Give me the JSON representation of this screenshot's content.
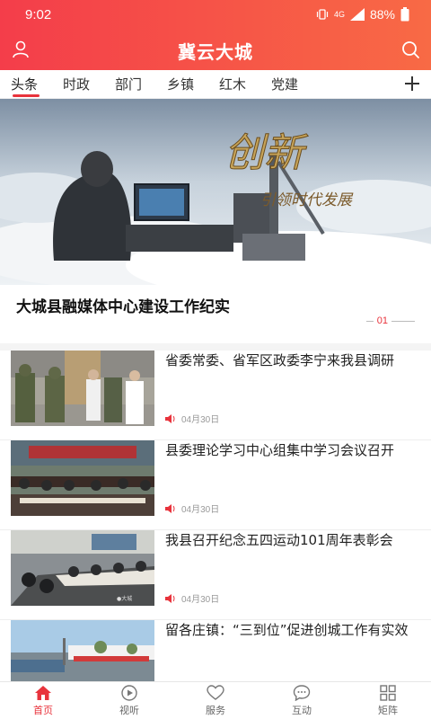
{
  "status_bar": {
    "time": "9:02",
    "battery": "88%",
    "network": "4G"
  },
  "header": {
    "title": "冀云大城"
  },
  "tabs": [
    {
      "label": "头条"
    },
    {
      "label": "时政"
    },
    {
      "label": "部门"
    },
    {
      "label": "乡镇"
    },
    {
      "label": "红木"
    },
    {
      "label": "党建"
    }
  ],
  "banner": {
    "overlay_text": "创新",
    "overlay_subtext": "引领时代发展",
    "caption": "大城县融媒体中心建设工作纪实",
    "page": "01"
  },
  "news": [
    {
      "title": "省委常委、省军区政委李宁来我县调研",
      "date": "04月30日"
    },
    {
      "title": "县委理论学习中心组集中学习会议召开",
      "date": "04月30日"
    },
    {
      "title": "我县召开纪念五四运动101周年表彰会",
      "date": "04月30日"
    },
    {
      "title": "留各庄镇：“三到位”促进创城工作有实效",
      "date": ""
    }
  ],
  "bottom_nav": [
    {
      "label": "首页",
      "icon": "home-icon"
    },
    {
      "label": "视听",
      "icon": "play-icon"
    },
    {
      "label": "服务",
      "icon": "heart-icon"
    },
    {
      "label": "互动",
      "icon": "chat-icon"
    },
    {
      "label": "矩阵",
      "icon": "grid-icon"
    }
  ],
  "colors": {
    "accent": "#e8333c",
    "header_start": "#f43d4a",
    "header_end": "#f86a45"
  }
}
